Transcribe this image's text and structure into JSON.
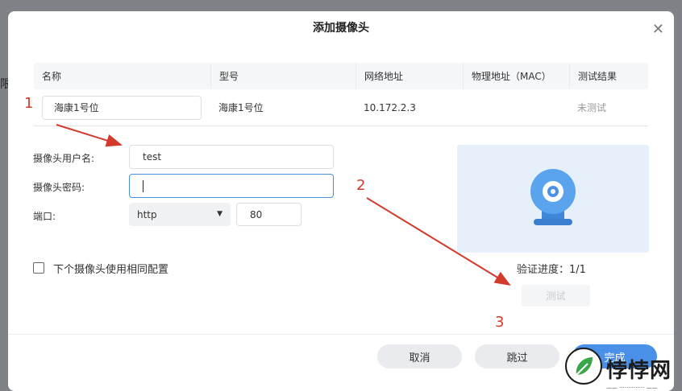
{
  "dialog": {
    "title": "添加摄像头",
    "close_icon": "close-icon"
  },
  "background": {
    "side_char": "限"
  },
  "table": {
    "headers": [
      "名称",
      "型号",
      "网络地址",
      "物理地址（MAC）",
      "测试结果"
    ],
    "row": {
      "name": "海康1号位",
      "model": "海康1号位",
      "ip": "10.172.2.3",
      "mac": "",
      "result": "未测试"
    }
  },
  "form": {
    "username_label": "摄像头用户名:",
    "username_value": "test",
    "password_label": "摄像头密码:",
    "password_value": "",
    "port_label": "端口:",
    "protocol": "http",
    "port": "80"
  },
  "preview": {
    "icon": "webcam-icon"
  },
  "same_config_label": "下个摄像头使用相同配置",
  "progress_text": "验证进度：1/1",
  "test_button": "测试",
  "footer": {
    "cancel": "取消",
    "skip": "跳过",
    "finish": "完成"
  },
  "annotations": [
    "1",
    "2",
    "3"
  ],
  "watermark": {
    "text": "悖悖网",
    "sub": "—— ·············· ——"
  },
  "colors": {
    "accent": "#4a90e8",
    "arrow": "#d33a2c"
  }
}
